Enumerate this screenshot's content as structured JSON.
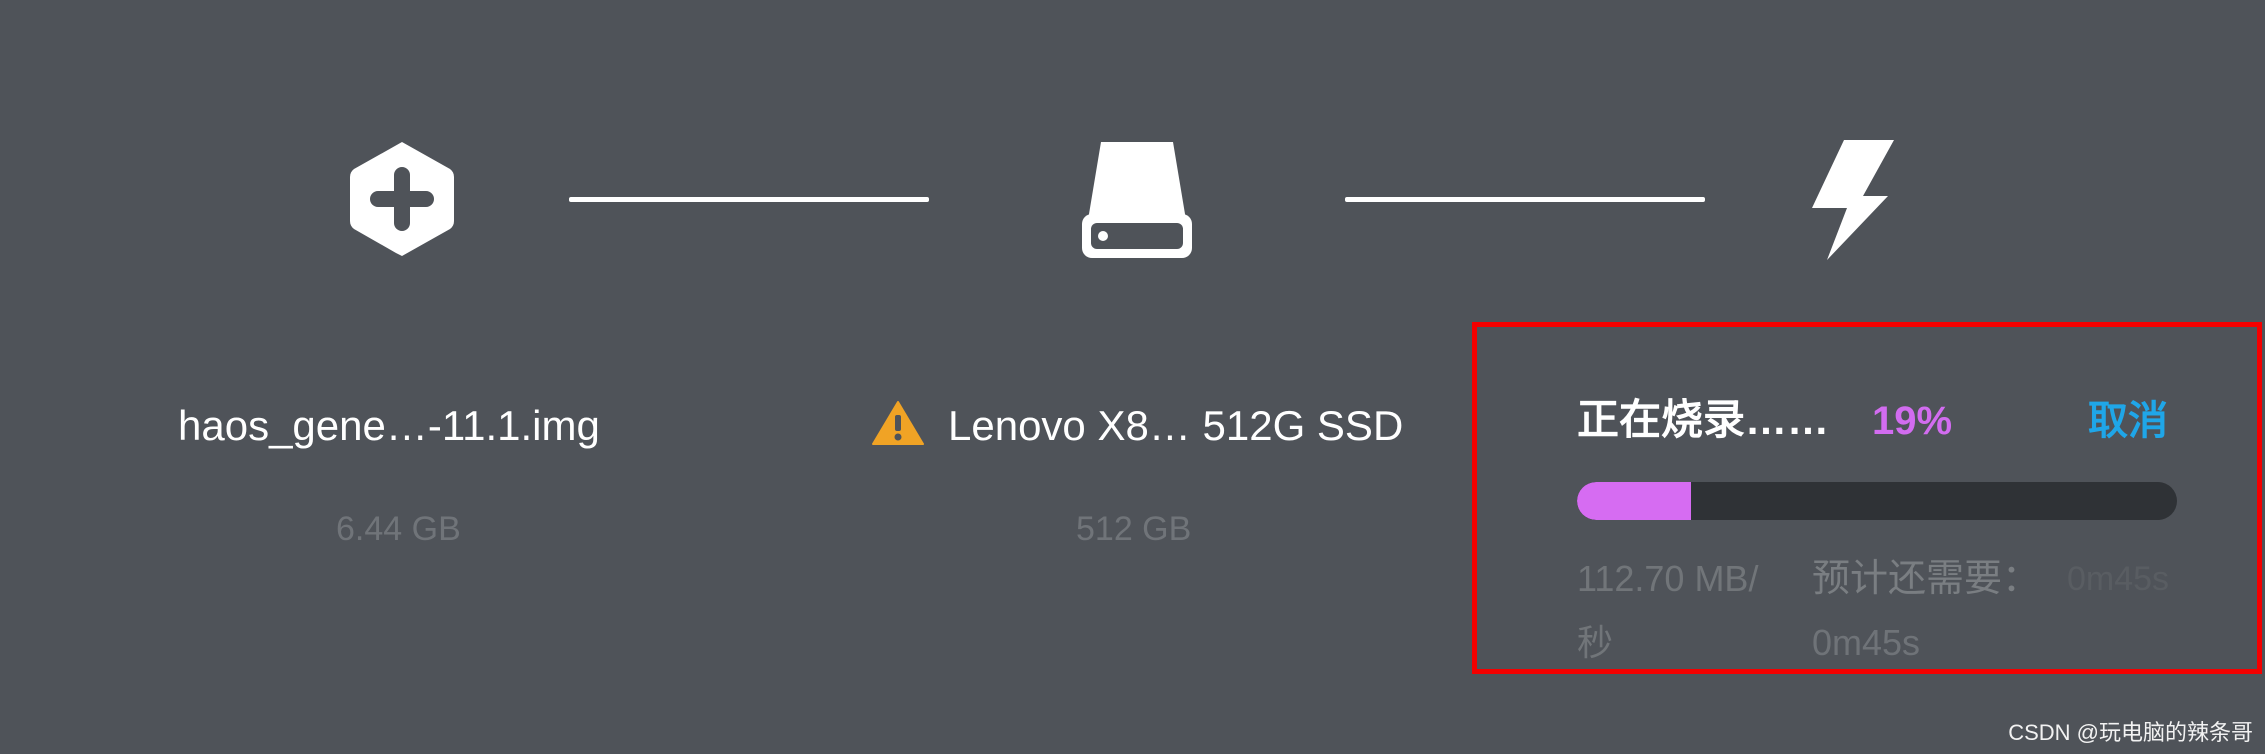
{
  "steps": [
    {
      "icon": "plus-hexagon-icon",
      "title": "haos_gene…-11.1.img",
      "subtitle": "6.44 GB"
    },
    {
      "icon": "drive-icon",
      "warning_icon": "warning-icon",
      "title": "Lenovo X8… 512G SSD",
      "subtitle": "512 GB"
    },
    {
      "icon": "lightning-icon"
    }
  ],
  "flash": {
    "status_label": "正在烧录……",
    "percent_label": "19%",
    "progress": 0.19,
    "cancel_label": "取消",
    "speed_label": "112.70 MB/秒",
    "eta_label": "预计还需要：",
    "eta_value": "0m45s"
  },
  "watermark": "CSDN @玩电脑的辣条哥",
  "colors": {
    "background": "#4f5359",
    "progress_fill": "#d66cf2",
    "cancel": "#1fa6e8",
    "warning": "#f0a325",
    "highlight_border": "#f40000"
  }
}
